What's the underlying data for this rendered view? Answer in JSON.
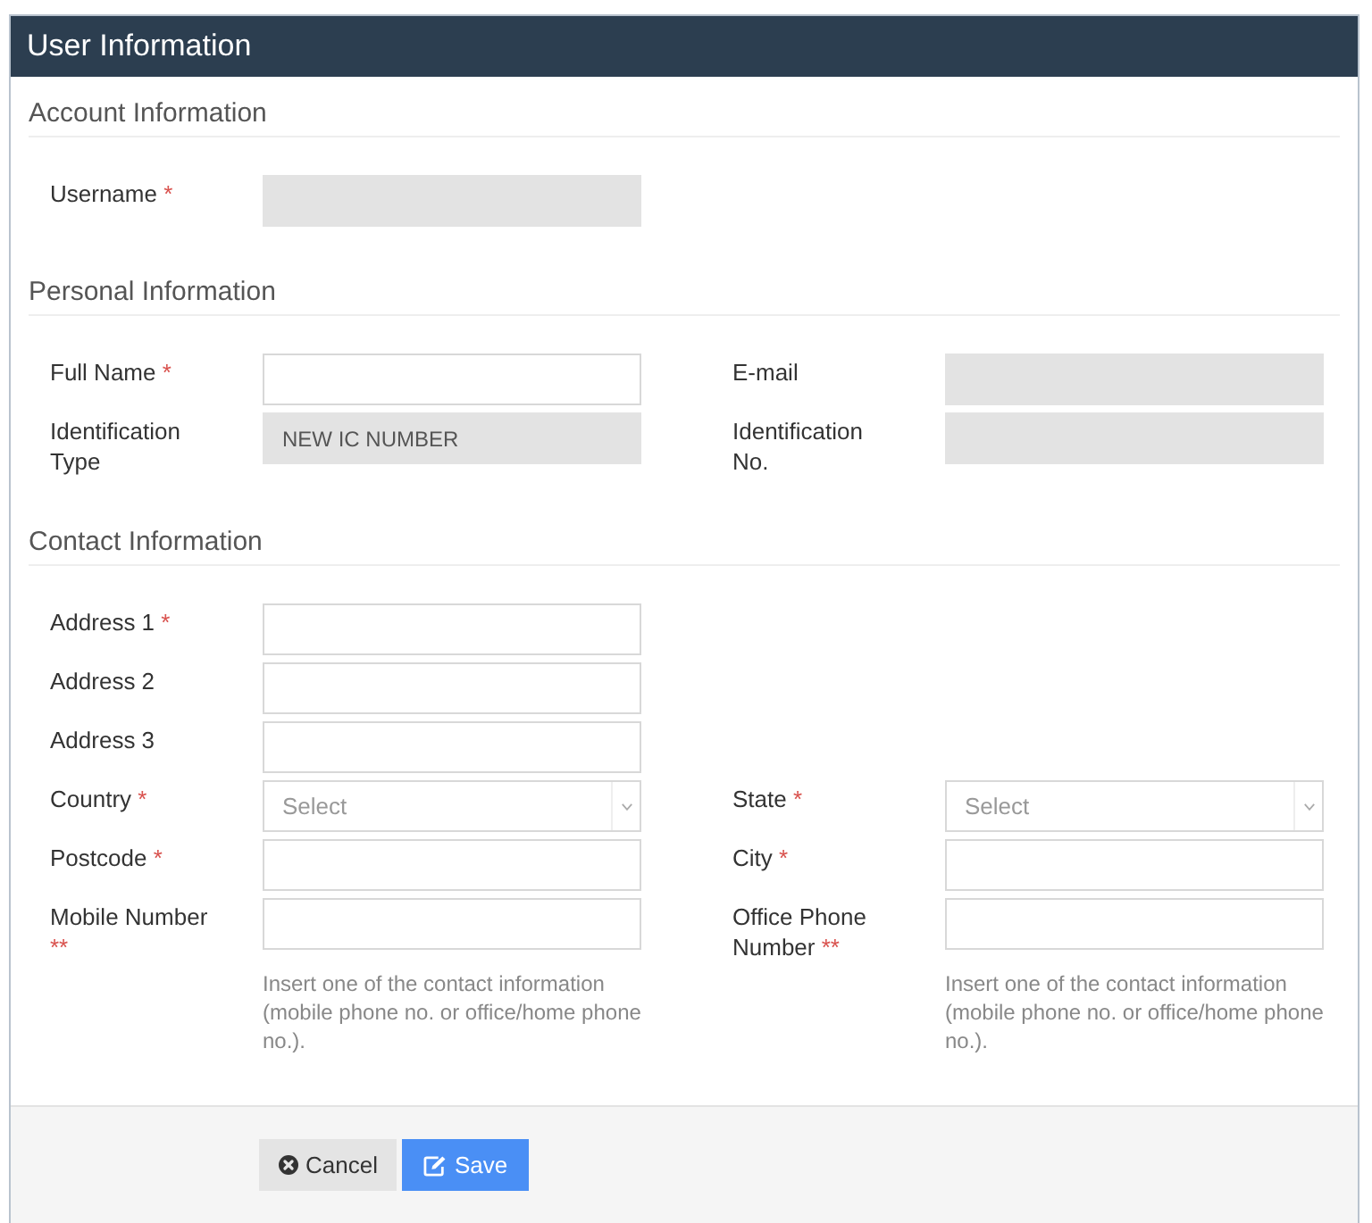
{
  "window": {
    "title": "User Information"
  },
  "sections": [
    {
      "heading": "Account Information",
      "rows": [
        {
          "fields": [
            {
              "label": "Username",
              "required_mark": "*",
              "kind": "text",
              "disabled": true
            }
          ]
        }
      ]
    },
    {
      "heading": "Personal Information",
      "rows": [
        {
          "fields": [
            {
              "label": "Full Name",
              "required_mark": "*",
              "kind": "text",
              "disabled": false
            },
            {
              "label": "E-mail",
              "kind": "text",
              "disabled": true
            }
          ]
        },
        {
          "fields": [
            {
              "label": "Identification Type",
              "kind": "text",
              "disabled": true,
              "value": "NEW IC NUMBER"
            },
            {
              "label": "Identification No.",
              "kind": "text",
              "disabled": true
            }
          ]
        }
      ]
    },
    {
      "heading": "Contact Information",
      "rows": [
        {
          "fields": [
            {
              "label": "Address 1",
              "required_mark": "*",
              "kind": "text",
              "disabled": false
            }
          ]
        },
        {
          "fields": [
            {
              "label": "Address 2",
              "kind": "text",
              "disabled": false
            }
          ]
        },
        {
          "fields": [
            {
              "label": "Address 3",
              "kind": "text",
              "disabled": false
            }
          ]
        },
        {
          "fields": [
            {
              "label": "Country",
              "required_mark": "*",
              "kind": "select",
              "disabled": false,
              "placeholder": "Select"
            },
            {
              "label": "State",
              "required_mark": "*",
              "kind": "select",
              "disabled": false,
              "placeholder": "Select"
            }
          ]
        },
        {
          "fields": [
            {
              "label": "Postcode",
              "required_mark": "*",
              "kind": "text",
              "disabled": false
            },
            {
              "label": "City",
              "required_mark": "*",
              "kind": "text",
              "disabled": false
            }
          ]
        },
        {
          "fields": [
            {
              "label": "Mobile Number",
              "required_mark": "**",
              "kind": "text",
              "disabled": false,
              "help": "Insert one of the contact information (mobile phone no. or office/home phone no.)."
            },
            {
              "label": "Office Phone Number",
              "required_mark": "**",
              "kind": "text",
              "disabled": false,
              "help": "Insert one of the contact information (mobile phone no. or office/home phone no.)."
            }
          ]
        }
      ]
    }
  ],
  "buttons": [
    {
      "label": "Cancel",
      "kind": "cancel"
    },
    {
      "label": "Save",
      "kind": "save"
    }
  ]
}
